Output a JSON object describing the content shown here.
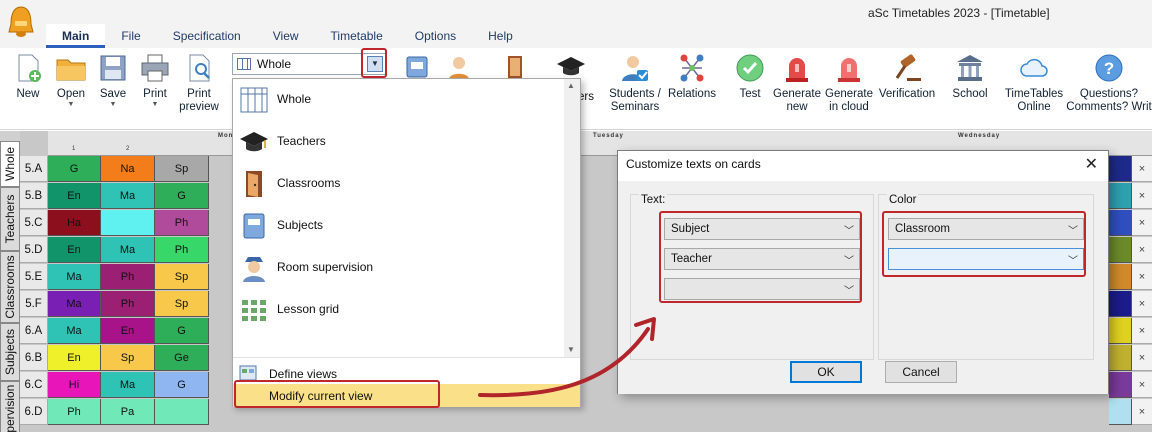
{
  "window": {
    "title": "aSc Timetables 2023  - [Timetable]"
  },
  "menu_tabs": [
    "Main",
    "File",
    "Specification",
    "View",
    "Timetable",
    "Options",
    "Help"
  ],
  "ribbon": {
    "new": "New",
    "open": "Open",
    "save": "Save",
    "print": "Print",
    "print_preview_1": "Print",
    "print_preview_2": "preview",
    "view_value": "Whole",
    "students_1": "Students /",
    "students_2": "Seminars",
    "relations": "Relations",
    "test": "Test",
    "generate_new_1": "Generate",
    "generate_new_2": "new",
    "generate_cloud_1": "Generate",
    "generate_cloud_2": "in cloud",
    "verification": "Verification",
    "school": "School",
    "timetables_online_1": "TimeTables",
    "timetables_online_2": "Online",
    "questions_1": "Questions?",
    "questions_2": "Comments? Writ",
    "partial_label": "ers"
  },
  "side_tabs": [
    "Whole",
    "Teachers",
    "Classrooms",
    "Subjects",
    "Supervision"
  ],
  "grid": {
    "days": [
      "Monday",
      "Tuesday",
      "Wednesday"
    ],
    "rows": [
      "5.A",
      "5.B",
      "5.C",
      "5.D",
      "5.E",
      "5.F",
      "6.A",
      "6.B",
      "6.C",
      "6.D"
    ],
    "close_glyph": "×",
    "period_2": "2",
    "period_1": "1"
  },
  "dropdown": {
    "items": [
      "Whole",
      "Teachers",
      "Classrooms",
      "Subjects",
      "Room supervision",
      "Lesson grid"
    ],
    "define_views": "Define views",
    "modify_current_view": "Modify current view"
  },
  "dialog": {
    "title": "Customize texts on cards",
    "text_group": "Text:",
    "color_group": "Color",
    "text_1": "Subject",
    "text_2": "Teacher",
    "text_3": "",
    "color_1": "Classroom",
    "color_2": "",
    "ok": "OK",
    "cancel": "Cancel"
  },
  "colors": {
    "accent_red": "#c0272d",
    "highlight_yellow": "#fbe08a",
    "focus_blue": "#4a90d9"
  }
}
